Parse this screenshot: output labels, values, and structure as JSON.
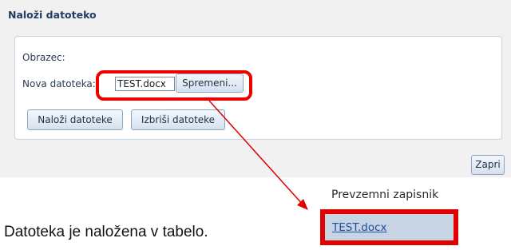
{
  "dialog": {
    "title": "Naloži datoteko",
    "form_label": "Obrazec:",
    "file_label": "Nova datoteka:",
    "file_value": "TEST.docx",
    "change_button": "Spremeni...",
    "upload_button": "Naloži datoteke",
    "delete_button": "Izbriši datoteke",
    "close_button": "Zapri"
  },
  "table": {
    "header": "Prevzemni zapisnik",
    "row_link": "TEST.docx"
  },
  "caption": "Datoteka je naložena v tabelo.",
  "colors": {
    "highlight": "#e00000",
    "title": "#1f3d66",
    "link": "#1f4f9e"
  }
}
